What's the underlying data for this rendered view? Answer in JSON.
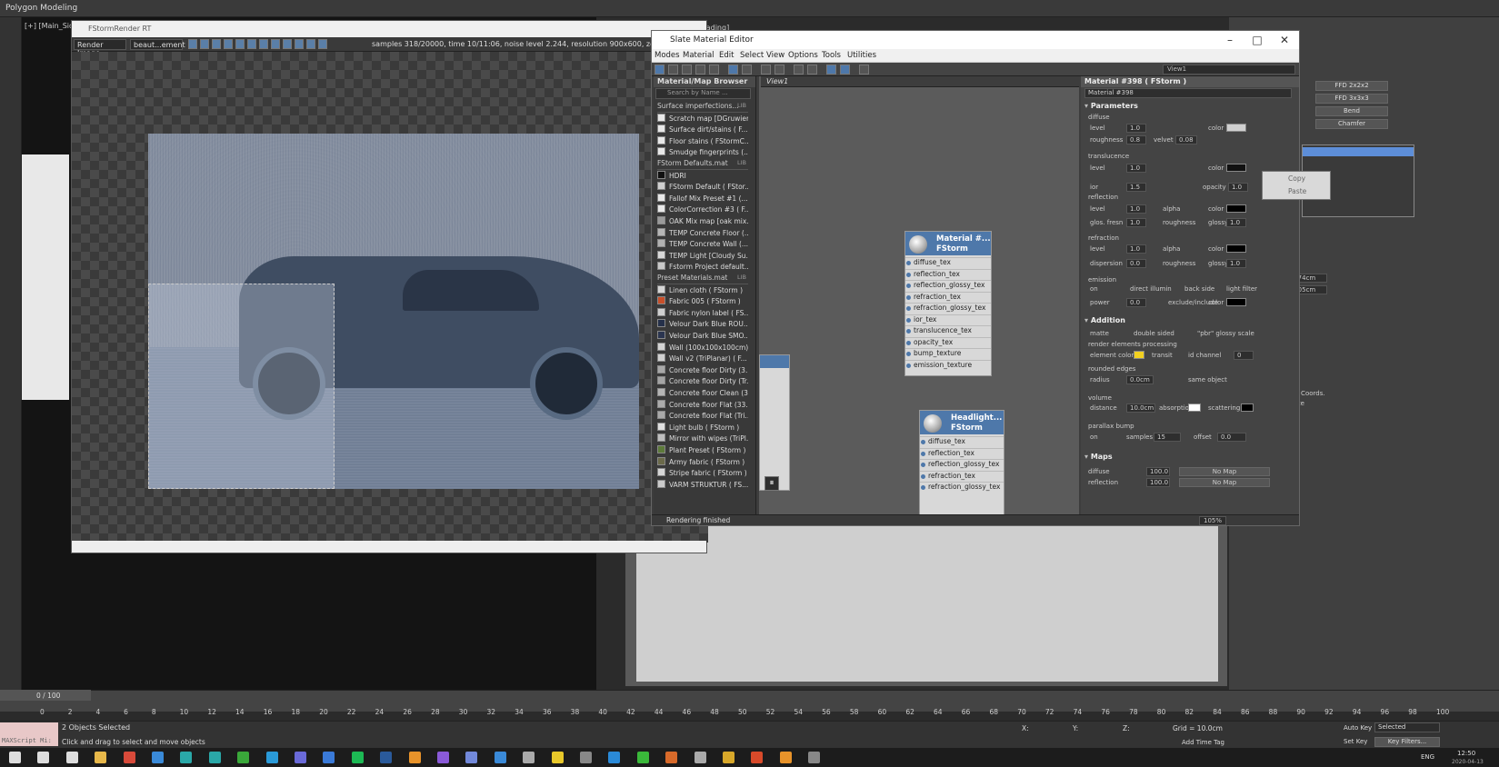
{
  "app": {
    "mode_label": "Polygon Modeling"
  },
  "viewports": {
    "left_label": "[+] [Main_Side",
    "right_label": "[-] [Default Shading]"
  },
  "render_window": {
    "title": "FStormRender RT",
    "channel_dropdown": "Render Image",
    "element_dropdown": "beaut...ement",
    "stats": "samples 318/20000, time 10/11:06, noise level 2.244, resolution 900x600, zoom 100%,"
  },
  "slate": {
    "title": "Slate Material Editor",
    "menu": [
      "Modes",
      "Material",
      "Edit",
      "Select",
      "View",
      "Options",
      "Tools",
      "Utilities"
    ],
    "view_dropdown": "View1",
    "view_tab": "View1",
    "status": "Rendering finished",
    "zoom": "105%",
    "browser": {
      "title": "Material/Map Browser",
      "search_placeholder": "Search by Name ...",
      "groups": [
        {
          "name": "Surface imperfections...",
          "tag": "LIB",
          "items": [
            {
              "label": "Scratch map [DGruwier...",
              "color": "#e8e8e8"
            },
            {
              "label": "Surface dirt/stains ( F...",
              "color": "#e8e8e8"
            },
            {
              "label": "Floor stains ( FStormC...",
              "color": "#e8e8e8"
            },
            {
              "label": "Smudge fingerprints (...",
              "color": "#e8e8e8"
            }
          ]
        },
        {
          "name": "FStorm Defaults.mat",
          "tag": "LIB",
          "items": [
            {
              "label": "HDRI",
              "color": "#111111"
            },
            {
              "label": "FStorm Default ( FStor...",
              "color": "#d0d0d0"
            },
            {
              "label": "Fallof Mix Preset #1 (...",
              "color": "#e8e8e8"
            },
            {
              "label": "ColorCorrection #3 ( F...",
              "color": "#e8e8e8"
            },
            {
              "label": "OAK Mix map [oak mix...",
              "color": "#9a9a9a"
            },
            {
              "label": "TEMP Concrete Floor (...",
              "color": "#b5b5b5"
            },
            {
              "label": "TEMP Concrete Wall (...",
              "color": "#b0b0b0"
            },
            {
              "label": "TEMP Light [Cloudy Su...",
              "color": "#d8d8d8"
            },
            {
              "label": "Fstorm Project default...",
              "color": "#c8c8c8"
            }
          ]
        },
        {
          "name": "Preset Materials.mat",
          "tag": "LIB",
          "items": [
            {
              "label": "Linen cloth ( FStorm )",
              "color": "#d6d6d6"
            },
            {
              "label": "Fabric 005 ( FStorm )",
              "color": "#c84f2a"
            },
            {
              "label": "Fabric nylon label ( FS...",
              "color": "#cfcfcf"
            },
            {
              "label": "Velour Dark Blue ROU...",
              "color": "#25304a"
            },
            {
              "label": "Velour Dark Blue SMO...",
              "color": "#2b3550"
            },
            {
              "label": "Wall (100x100x100cm)...",
              "color": "#d4d4d4"
            },
            {
              "label": "Wall v2 (TriPlanar) ( F...",
              "color": "#d0d0d0"
            },
            {
              "label": "Concrete floor Dirty (3...",
              "color": "#a8a8a8"
            },
            {
              "label": "Concrete floor Dirty (Tr...",
              "color": "#a4a4a4"
            },
            {
              "label": "Concrete floor Clean (3...",
              "color": "#b4b4b4"
            },
            {
              "label": "Concrete floor Flat (33...",
              "color": "#acacac"
            },
            {
              "label": "Concrete floor Flat (Tri...",
              "color": "#a9a9a9"
            },
            {
              "label": "Light bulb ( FStorm )",
              "color": "#e0e0e0"
            },
            {
              "label": "Mirror with wipes (TriPl...",
              "color": "#bfbfbf"
            },
            {
              "label": "Plant Preset ( FStorm )",
              "color": "#5d7a3a"
            },
            {
              "label": "Army fabric ( FStorm )",
              "color": "#6b6a4a"
            },
            {
              "label": "Stripe fabric ( FStorm )",
              "color": "#d5d5d5"
            },
            {
              "label": "VARM STRUKTUR ( FS...",
              "color": "#cacaca"
            }
          ]
        }
      ]
    },
    "node1": {
      "title1": "Material #...",
      "title2": "FStorm",
      "slots": [
        "diffuse_tex",
        "reflection_tex",
        "reflection_glossy_tex",
        "refraction_tex",
        "refraction_glossy_tex",
        "ior_tex",
        "translucence_tex",
        "opacity_tex",
        "bump_texture",
        "emission_texture"
      ]
    },
    "node2": {
      "title1": "Headlight...",
      "title2": "FStorm",
      "slots": [
        "diffuse_tex",
        "reflection_tex",
        "reflection_glossy_tex",
        "refraction_tex",
        "refraction_glossy_tex"
      ]
    },
    "params": {
      "header": "Material #398 ( FStorm )",
      "name": "Material #398",
      "parameters_label": "Parameters",
      "diffuse": {
        "label": "diffuse",
        "level_lbl": "level",
        "level": "1.0",
        "roughness_lbl": "roughness",
        "roughness": "0.8",
        "velvet_lbl": "velvet",
        "velvet": "0.08",
        "color_lbl": "color"
      },
      "translucence": {
        "label": "translucence",
        "level_lbl": "level",
        "level": "1.0",
        "color_lbl": "color"
      },
      "ior_lbl": "ior",
      "ior": "1.5",
      "opacity_lbl": "opacity",
      "opacity": "1.0",
      "reflection": {
        "label": "reflection",
        "level_lbl": "level",
        "level": "1.0",
        "alpha_lbl": "alpha",
        "color_lbl": "color",
        "gloss_fresn_lbl": "glos. fresn",
        "gloss_fresn": "1.0",
        "roughness_lbl": "roughness",
        "glossy_lbl": "glossy",
        "glossy": "1.0"
      },
      "refraction": {
        "label": "refraction",
        "level_lbl": "level",
        "level": "1.0",
        "alpha_lbl": "alpha",
        "color_lbl": "color",
        "dispersion_lbl": "dispersion",
        "dispersion": "0.0",
        "roughness_lbl": "roughness",
        "glossy_lbl": "glossy",
        "glossy": "1.0"
      },
      "emission": {
        "label": "emission",
        "on_lbl": "on",
        "direct_lbl": "direct illumin",
        "back_lbl": "back side",
        "light_filter_lbl": "light filter",
        "power_lbl": "power",
        "power": "0.0",
        "excl_lbl": "exclude/include",
        "color_lbl": "color"
      },
      "addition_label": "Addition",
      "matte_lbl": "matte",
      "double_lbl": "double sided",
      "pbr_lbl": "\"pbr\" glossy scale",
      "rep_lbl": "render elements processing",
      "elem_color_lbl": "element color",
      "transit_lbl": "transit",
      "id_lbl": "id channel",
      "id": "0",
      "rounded_lbl": "rounded edges",
      "radius_lbl": "radius",
      "radius": "0.0cm",
      "same_obj_lbl": "same object",
      "volume_lbl": "volume",
      "distance_lbl": "distance",
      "distance": "10.0cm",
      "absorption_lbl": "absorption",
      "scattering_lbl": "scattering",
      "parallax_lbl": "parallax bump",
      "p_on_lbl": "on",
      "samples_lbl": "samples",
      "samples": "15",
      "offset_lbl": "offset",
      "offset": "0.0",
      "maps_label": "Maps",
      "maps": [
        {
          "label": "diffuse",
          "amount": "100.0",
          "map": "No Map"
        },
        {
          "label": "reflection",
          "amount": "100.0",
          "map": "No Map"
        }
      ],
      "colors": {
        "diffuse": "#d0d0d0",
        "translucence": "#111111",
        "reflection": "#000000",
        "refraction": "#000000",
        "emission": "#000000",
        "element": "#f2d020",
        "absorption": "#ffffff",
        "scattering": "#000000"
      }
    },
    "context_menu": [
      "Copy",
      "Paste"
    ]
  },
  "right_panel": {
    "buttons": [
      "FFD 2x2x2",
      "FFD 3x3x3",
      "Bend",
      "Chamfer"
    ],
    "field1": ".774cm",
    "field2": ".105cm",
    "label1": "ing Coords.",
    "label2": "-Size"
  },
  "timeline": {
    "frame": "0 / 100",
    "ticks": [
      "0",
      "2",
      "4",
      "6",
      "8",
      "10",
      "12",
      "14",
      "16",
      "18",
      "20",
      "22",
      "24",
      "26",
      "28",
      "30",
      "32",
      "34",
      "36",
      "38",
      "40",
      "42",
      "44",
      "46",
      "48",
      "50",
      "52",
      "54",
      "56",
      "58",
      "60",
      "62",
      "64",
      "66",
      "68",
      "70",
      "72",
      "74",
      "76",
      "78",
      "80",
      "82",
      "84",
      "86",
      "88",
      "90",
      "92",
      "94",
      "96",
      "98",
      "100"
    ]
  },
  "status": {
    "maxscript": "MAXScript Mi:",
    "selected": "2 Objects Selected",
    "hint": "Click and drag to select and move objects",
    "x_lbl": "X:",
    "y_lbl": "Y:",
    "z_lbl": "Z:",
    "grid": "Grid = 10.0cm",
    "add_time_tag": "Add Time Tag",
    "auto_key": "Auto Key",
    "selected_dd": "Selected",
    "set_key": "Set Key",
    "key_filters": "Key Filters..."
  },
  "taskbar": {
    "lang": "ENG",
    "time": "12:50",
    "date": "2020-04-13",
    "icons": [
      {
        "name": "start-icon",
        "color": "#dddddd"
      },
      {
        "name": "search-icon",
        "color": "#dddddd"
      },
      {
        "name": "taskview-icon",
        "color": "#dddddd"
      },
      {
        "name": "explorer-icon",
        "color": "#e8b84a"
      },
      {
        "name": "chrome-icon",
        "color": "#d84a3a"
      },
      {
        "name": "app-icon",
        "color": "#3a8ad8"
      },
      {
        "name": "max-icon",
        "color": "#2aa8a8"
      },
      {
        "name": "max2-icon",
        "color": "#2aa8a8"
      },
      {
        "name": "xbox-icon",
        "color": "#3aa83a"
      },
      {
        "name": "skype-icon",
        "color": "#2a9ad8"
      },
      {
        "name": "app2-icon",
        "color": "#6a6ad8"
      },
      {
        "name": "app3-icon",
        "color": "#3a7ad8"
      },
      {
        "name": "spotify-icon",
        "color": "#1db954"
      },
      {
        "name": "photoshop-icon",
        "color": "#2a5a9a"
      },
      {
        "name": "illustrator-icon",
        "color": "#e8932a"
      },
      {
        "name": "app4-icon",
        "color": "#8a5ad8"
      },
      {
        "name": "discord-icon",
        "color": "#7289da"
      },
      {
        "name": "lightroom-icon",
        "color": "#3a8ad8"
      },
      {
        "name": "app5-icon",
        "color": "#aaaaaa"
      },
      {
        "name": "app6-icon",
        "color": "#e8c82a"
      },
      {
        "name": "app7-icon",
        "color": "#888888"
      },
      {
        "name": "app8-icon",
        "color": "#2a8ad8"
      },
      {
        "name": "app9-icon",
        "color": "#3ab83a"
      },
      {
        "name": "app10-icon",
        "color": "#d86a2a"
      },
      {
        "name": "app11-icon",
        "color": "#aaaaaa"
      },
      {
        "name": "app12-icon",
        "color": "#d8a82a"
      },
      {
        "name": "app13-icon",
        "color": "#d84a2a"
      },
      {
        "name": "app14-icon",
        "color": "#e8932a"
      },
      {
        "name": "app15-icon",
        "color": "#888888"
      }
    ]
  }
}
